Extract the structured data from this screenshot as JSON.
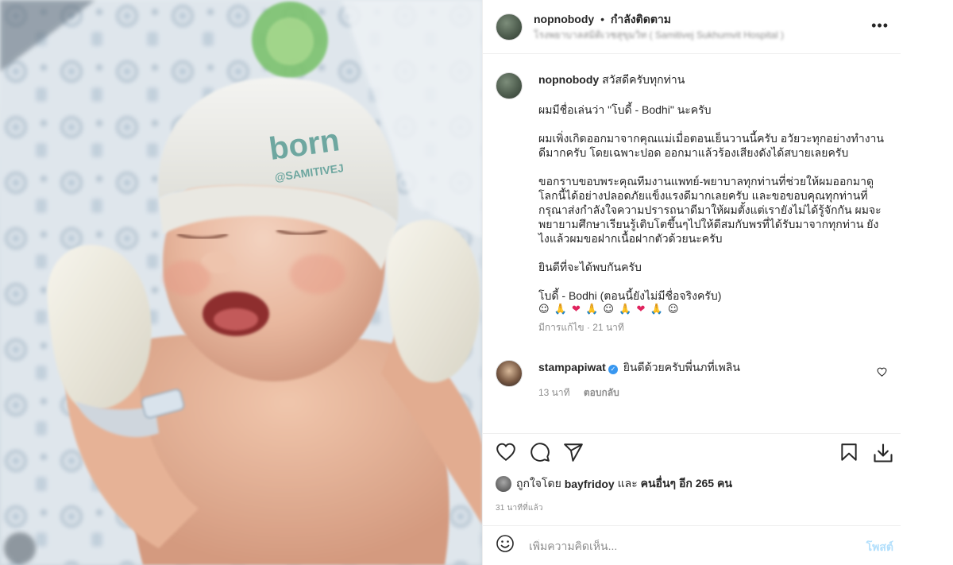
{
  "post": {
    "username": "nopnobody",
    "follow_state": "กำลังติดตาม",
    "separator": "•",
    "location": "โรงพยาบาลสมิติเวชสุขุมวิท ( Samitivej Sukhumvit Hospital )",
    "more_label": "•••"
  },
  "photo": {
    "hat_text_top": "born",
    "hat_text_bottom": "@SAMITIVEJ"
  },
  "caption": {
    "username": "nopnobody",
    "first_line": "สวัสดีครับทุกท่าน",
    "paragraphs": [
      "ผมมีชื่อเล่นว่า \"โบดี้ - Bodhi\" นะครับ",
      "ผมเพิ่งเกิดออกมาจากคุณแม่เมื่อตอนเย็นวานนี้ครับ อวัยวะทุกอย่างทำงานดีมากครับ โดยเฉพาะปอด ออกมาแล้วร้องเสียงดังได้สบายเลยครับ",
      "ขอกราบขอบพระคุณทีมงานแพทย์-พยาบาลทุกท่านที่ช่วยให้ผมออกมาดูโลกนี้ได้อย่างปลอดภัยแข็งแรงดีมากเลยครับ และขอขอบคุณทุกท่านที่กรุณาส่งกำลังใจความปรารถนาดีมาให้ผมตั้งแต่เรายังไม่ได้รู้จักกัน ผมจะพยายามศึกษาเรียนรู้เติบโตขึ้นๆไปให้ดีสมกับพรที่ได้รับมาจากทุกท่าน ยังไงแล้วผมขอฝากเนื้อฝากตัวด้วยนะครับ",
      "ยินดีที่จะได้พบกันครับ"
    ],
    "signature": "โบดี้ - Bodhi (ตอนนี้ยังไม่มีชื่อจริงครับ)",
    "emoji_line": "☺🙏❤🙏☺🙏❤🙏☺",
    "edited": "มีการแก้ไข · 21 นาที"
  },
  "comment": {
    "username": "stampapiwat",
    "verified_mark": "✓",
    "text": "ยินดีด้วยครับพี่นภที่เพลิน",
    "time": "13 นาที",
    "reply_label": "ตอบกลับ"
  },
  "likes": {
    "prefix": "ถูกใจโดย",
    "user": "bayfridoy",
    "middle": "และ",
    "others": "คนอื่นๆ อีก 265 คน"
  },
  "timestamp": "31 นาทีที่แล้ว",
  "add_comment": {
    "placeholder": "เพิ่มความคิดเห็น...",
    "post_label": "โพสต์"
  },
  "icons": {
    "more": "more-icon",
    "like": "heart-icon",
    "comment": "comment-icon",
    "share": "share-icon",
    "save": "bookmark-icon",
    "download": "download-icon",
    "emoji": "smile-icon",
    "comment_like": "heart-icon",
    "verified": "verified-icon"
  },
  "colors": {
    "text": "#262626",
    "secondary": "#8e8e8e",
    "border": "#efefef",
    "verified": "#3897f0",
    "post_button_disabled": "#b2dffc",
    "heart_emoji": "#e0245e"
  }
}
